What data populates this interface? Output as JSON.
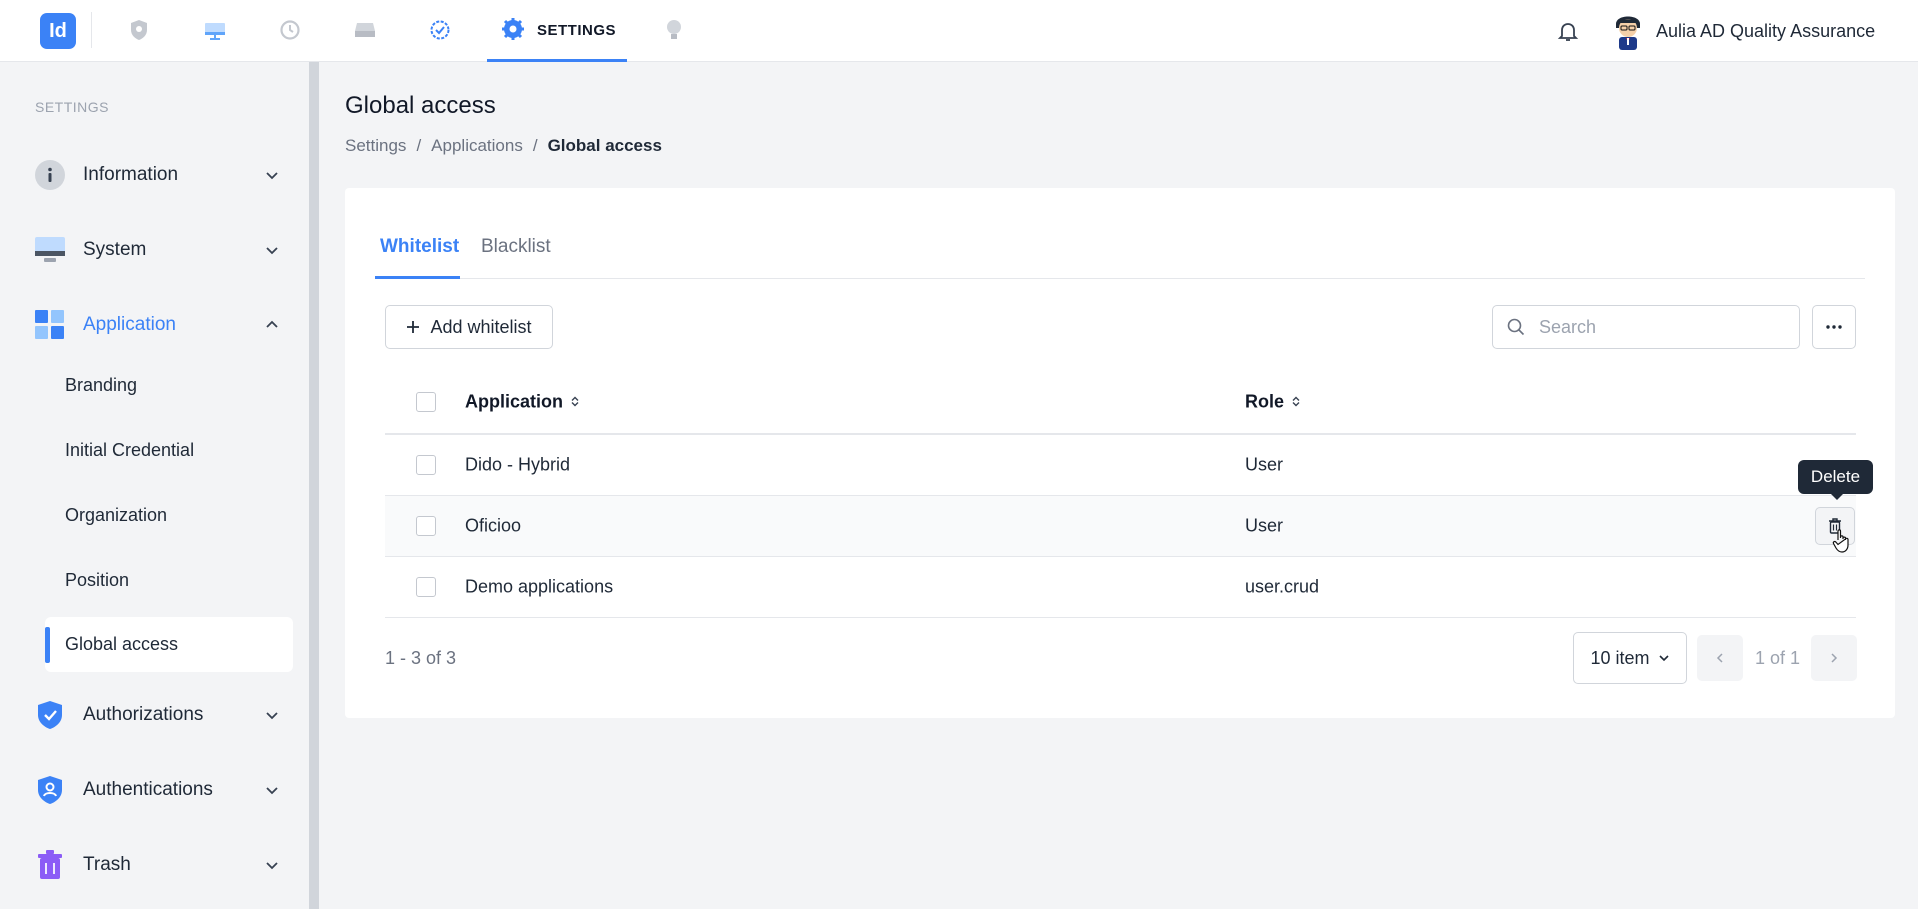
{
  "topbar": {
    "logo_text": "Id",
    "active_nav_label": "SETTINGS",
    "nav_icons": [
      "shield-icon",
      "monitor-icon",
      "history-icon",
      "drive-icon",
      "check-circle-icon",
      "gear-icon",
      "bulb-icon"
    ],
    "user_name": "Aulia AD Quality Assurance",
    "accent_color": "#3b82f6"
  },
  "sidebar": {
    "caption": "SETTINGS",
    "items": [
      {
        "label": "Information",
        "icon": "info-icon"
      },
      {
        "label": "System",
        "icon": "monitor-icon"
      },
      {
        "label": "Application",
        "icon": "apps-grid-icon"
      },
      {
        "label": "Authorizations",
        "icon": "shield-check-icon"
      },
      {
        "label": "Authentications",
        "icon": "shield-user-icon"
      },
      {
        "label": "Trash",
        "icon": "trash-icon"
      }
    ],
    "sub_items": [
      "Branding",
      "Initial Credential",
      "Organization",
      "Position",
      "Global access"
    ]
  },
  "page": {
    "title": "Global access",
    "breadcrumb": [
      "Settings",
      "Applications",
      "Global access"
    ],
    "breadcrumb_sep": "/"
  },
  "tabs": [
    "Whitelist",
    "Blacklist"
  ],
  "toolbar": {
    "add_label": "Add whitelist",
    "search_placeholder": "Search"
  },
  "table": {
    "columns": [
      "Application",
      "Role"
    ],
    "rows": [
      {
        "application": "Dido - Hybrid",
        "role": "User"
      },
      {
        "application": "Oficioo",
        "role": "User"
      },
      {
        "application": "Demo applications",
        "role": "user.crud"
      }
    ],
    "tooltip": "Delete"
  },
  "pagination": {
    "range": "1 - 3 of 3",
    "page_size": "10 item",
    "page": "1 of 1"
  }
}
